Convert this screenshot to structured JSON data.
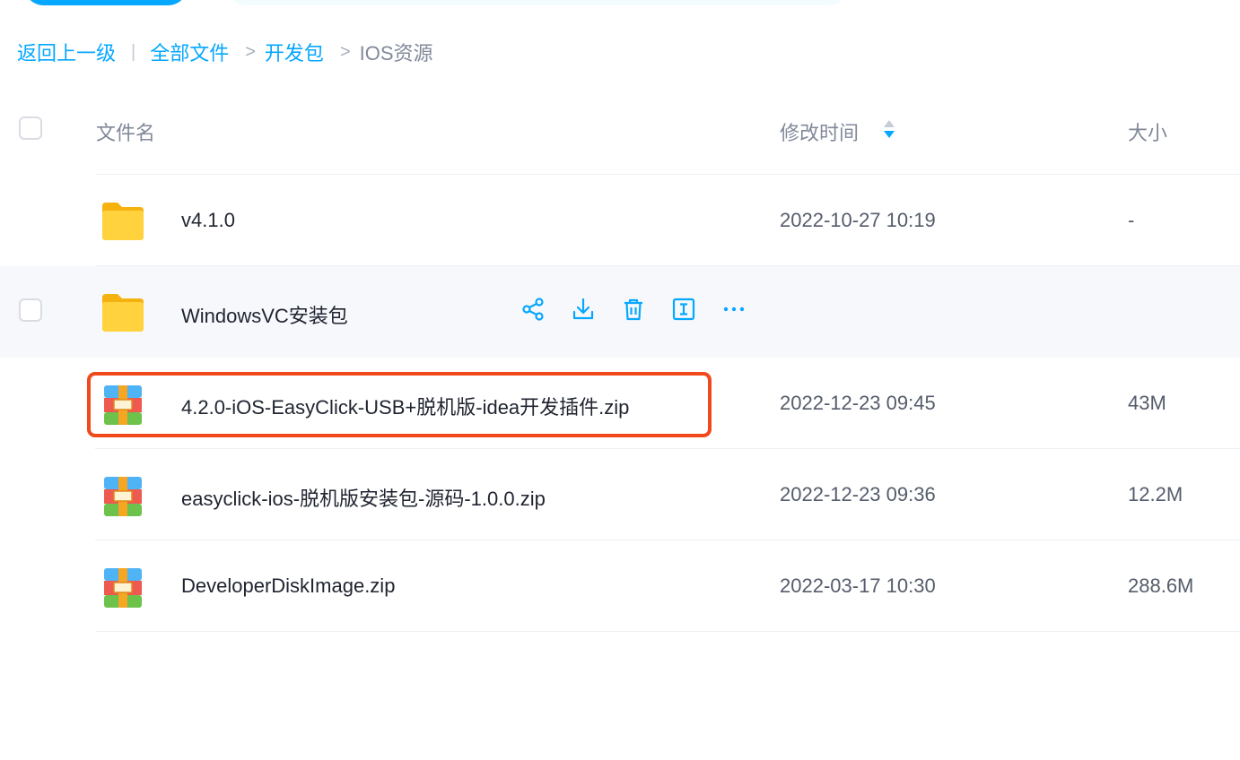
{
  "breadcrumb": {
    "back": "返回上一级",
    "separator": "|",
    "items": [
      "全部文件",
      "开发包"
    ],
    "arrow": ">",
    "current": "IOS资源"
  },
  "table": {
    "headers": {
      "name": "文件名",
      "modified": "修改时间",
      "size": "大小"
    },
    "rows": [
      {
        "name": "v4.1.0",
        "modified": "2022-10-27 10:19",
        "size": "-",
        "type": "folder-icon"
      },
      {
        "name": "WindowsVC安装包",
        "modified": "",
        "size": "",
        "type": "folder-icon"
      },
      {
        "name": "4.2.0-iOS-EasyClick-USB+脱机版-idea开发插件.zip",
        "modified": "2022-12-23 09:45",
        "size": "43M",
        "type": "zip-icon"
      },
      {
        "name": "easyclick-ios-脱机版安装包-源码-1.0.0.zip",
        "modified": "2022-12-23 09:36",
        "size": "12.2M",
        "type": "zip-icon"
      },
      {
        "name": "DeveloperDiskImage.zip",
        "modified": "2022-03-17 10:30",
        "size": "288.6M",
        "type": "zip-icon"
      }
    ]
  },
  "row_actions": [
    "share-icon",
    "download-icon",
    "delete-icon",
    "rename-icon",
    "more-icon"
  ],
  "colors": {
    "accent": "#06a7ff",
    "highlight": "#f0491c",
    "hover_row": "#f7f8fb"
  }
}
